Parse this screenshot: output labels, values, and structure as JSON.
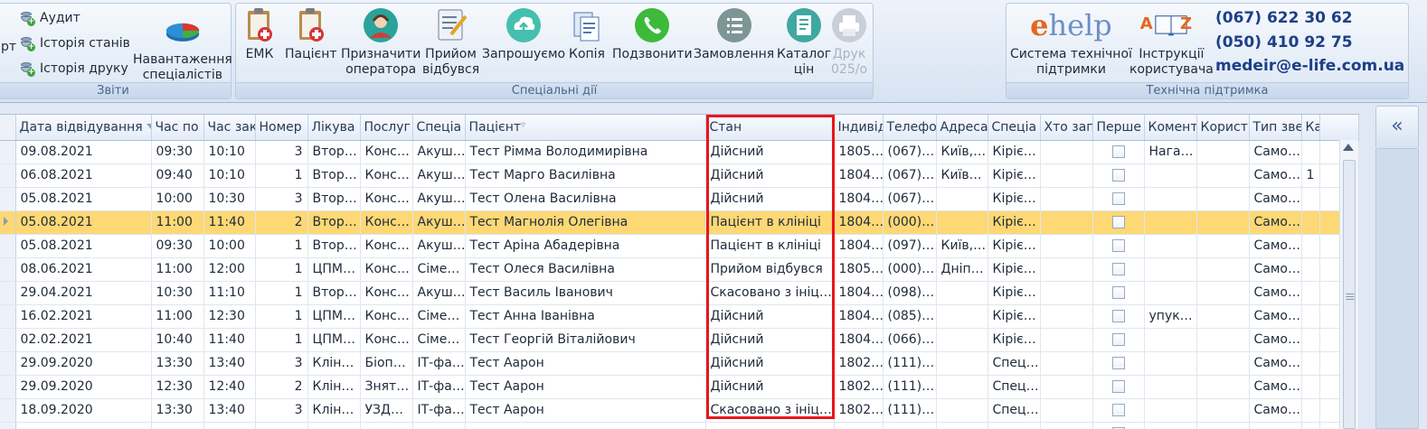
{
  "ribbon": {
    "reports_group": {
      "label": "Звіти",
      "left_cut_label": "рт",
      "items": [
        "Аудит",
        "Історія станів",
        "Історія друку"
      ],
      "load_label_1": "Навантаження",
      "load_label_2": "спеціалістів"
    },
    "special_group": {
      "label": "Спеціальні дії",
      "buttons": [
        {
          "l1": "ЕМК",
          "l2": ""
        },
        {
          "l1": "Пацієнт",
          "l2": ""
        },
        {
          "l1": "Призначити",
          "l2": "оператора"
        },
        {
          "l1": "Прийом",
          "l2": "відбувся"
        },
        {
          "l1": "Запрошуємо",
          "l2": ""
        },
        {
          "l1": "Копія",
          "l2": ""
        },
        {
          "l1": "Подзвонити",
          "l2": ""
        },
        {
          "l1": "Замовлення",
          "l2": ""
        },
        {
          "l1": "Каталог",
          "l2": "цін"
        },
        {
          "l1": "Друк",
          "l2": "025/о"
        }
      ]
    },
    "support_group": {
      "label": "Технічна підтримка",
      "ehelp_logo_e": "e",
      "ehelp_logo_rest": "help",
      "ehelp_l1": "Система технічної",
      "ehelp_l2": "підтримки",
      "az_logo": "A Z",
      "instr_l1": "Інструкції",
      "instr_l2": "користувача",
      "phone1": "(067) 622 30 62",
      "phone2": "(050) 410 92 75",
      "email": "medeir@e-life.com.ua"
    }
  },
  "grid": {
    "columns": [
      "Дата відвідування",
      "Час по",
      "Час зак",
      "Номер",
      "Лікува",
      "Послуг",
      "Спеціа",
      "Пацієнт",
      "Стан",
      "Індивід",
      "Телефо",
      "Адреса",
      "Спеціа",
      "Хто зап",
      "Перше",
      "Комент",
      "Корист",
      "Тип зве",
      "Кабін"
    ],
    "rows": [
      [
        "09.08.2021",
        "09:30",
        "10:10",
        "3",
        "Втор…",
        "Конс…",
        "Акуш…",
        "Тест Рімма Володимирівна",
        "Дійсний",
        "1805…",
        "(067)…",
        "Київ,…",
        "Кіріє…",
        "",
        false,
        "Нага…",
        "",
        "Само…",
        ""
      ],
      [
        "06.08.2021",
        "09:40",
        "10:10",
        "1",
        "Втор…",
        "Конс…",
        "Акуш…",
        "Тест Марго Василівна",
        "Дійсний",
        "1804…",
        "(067)…",
        "Київ…",
        "Кіріє…",
        "",
        false,
        "",
        "",
        "Само…",
        "1"
      ],
      [
        "05.08.2021",
        "10:00",
        "10:30",
        "3",
        "Втор…",
        "Конс…",
        "Акуш…",
        "Тест Олена Василівна",
        "Дійсний",
        "1804…",
        "(067)…",
        "",
        "Кіріє…",
        "",
        false,
        "",
        "",
        "Само…",
        ""
      ],
      [
        "05.08.2021",
        "11:00",
        "11:40",
        "2",
        "Втор…",
        "Конс…",
        "Акуш…",
        "Тест Магнолія Олегівна",
        "Пацієнт в клініці",
        "1804…",
        "(000)…",
        "",
        "Кіріє…",
        "",
        false,
        "",
        "",
        "Само…",
        ""
      ],
      [
        "05.08.2021",
        "09:30",
        "10:00",
        "1",
        "Втор…",
        "Конс…",
        "Акуш…",
        "Тест Аріна Абадерівна",
        "Пацієнт в клініці",
        "1804…",
        "(097)…",
        "Київ,…",
        "Кіріє…",
        "",
        false,
        "",
        "",
        "Само…",
        ""
      ],
      [
        "08.06.2021",
        "11:00",
        "12:00",
        "1",
        "ЦПМ…",
        "Конс…",
        "Сіме…",
        "Тест Олеся Василівна",
        "Прийом відбувся",
        "1805…",
        "(000)…",
        "Дніп…",
        "Кіріє…",
        "",
        false,
        "",
        "",
        "Само…",
        ""
      ],
      [
        "29.04.2021",
        "10:30",
        "11:10",
        "1",
        "Втор…",
        "Конс…",
        "Акуш…",
        "Тест Василь Іванович",
        "Скасовано з ініц…",
        "1804…",
        "(098)…",
        "",
        "Кіріє…",
        "",
        false,
        "",
        "",
        "Само…",
        ""
      ],
      [
        "16.02.2021",
        "11:00",
        "12:30",
        "1",
        "ЦПМ…",
        "Конс…",
        "Сіме…",
        "Тест Анна Іванівна",
        "Дійсний",
        "1804…",
        "(085)…",
        "",
        "Кіріє…",
        "",
        false,
        "упук…",
        "",
        "Само…",
        ""
      ],
      [
        "02.02.2021",
        "10:40",
        "11:40",
        "1",
        "ЦПМ…",
        "Конс…",
        "Сіме…",
        "Тест Георгій Віталійович",
        "Дійсний",
        "1804…",
        "(066)…",
        "",
        "Кіріє…",
        "",
        false,
        "",
        "",
        "Само…",
        ""
      ],
      [
        "29.09.2020",
        "13:30",
        "13:40",
        "3",
        "Клін…",
        "Біоп…",
        "ІТ-фа…",
        "Тест Аарон",
        "Дійсний",
        "1802…",
        "(111)…",
        "",
        "Спец…",
        "",
        false,
        "",
        "",
        "Само…",
        ""
      ],
      [
        "29.09.2020",
        "12:30",
        "12:40",
        "2",
        "Клін…",
        "Знят…",
        "ІТ-фа…",
        "Тест Аарон",
        "Дійсний",
        "1802…",
        "(111)…",
        "",
        "Спец…",
        "",
        false,
        "",
        "",
        "Само…",
        ""
      ],
      [
        "18.09.2020",
        "13:30",
        "13:40",
        "3",
        "Клін…",
        "УЗД…",
        "ІТ-фа…",
        "Тест Аарон",
        "Скасовано з ініц…",
        "1802…",
        "(111)…",
        "",
        "Спец…",
        "",
        false,
        "",
        "",
        "Само…",
        ""
      ],
      [
        "",
        "",
        "",
        "",
        "",
        "",
        "",
        "",
        "",
        "",
        "",
        "",
        "",
        "",
        false,
        "",
        "",
        "",
        ""
      ]
    ],
    "selected_row": 3,
    "highlight_color": "#e8161b",
    "selection_color": "#fdd875"
  },
  "side_panel": {
    "collapse_glyph": "«"
  }
}
